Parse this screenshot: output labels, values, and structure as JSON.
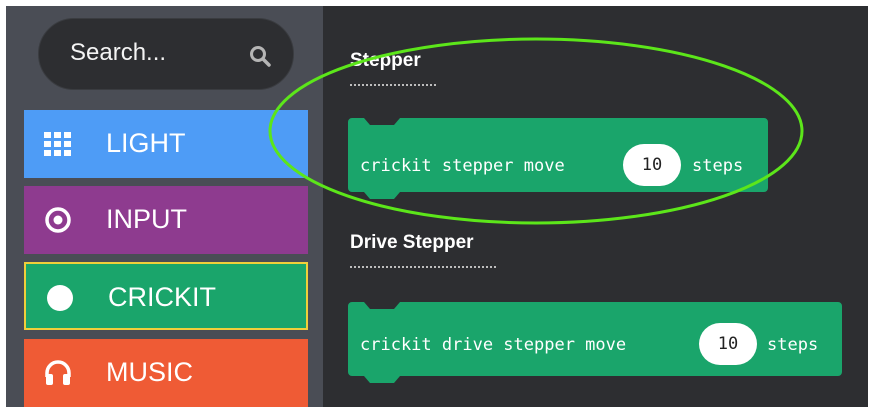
{
  "search": {
    "placeholder": "Search..."
  },
  "categories": [
    {
      "label": "LIGHT",
      "icon": "grid-icon",
      "color": "#4e9cf6"
    },
    {
      "label": "INPUT",
      "icon": "circle-target-icon",
      "color": "#8e3b8f"
    },
    {
      "label": "CRICKIT",
      "icon": "filled-circle-icon",
      "color": "#1aa56b"
    },
    {
      "label": "MUSIC",
      "icon": "headphones-icon",
      "color": "#ef5b35"
    }
  ],
  "flyout": {
    "sections": [
      {
        "heading": "Stepper",
        "block": {
          "prefix": "crickit stepper move",
          "value": "10",
          "suffix": "steps"
        }
      },
      {
        "heading": "Drive Stepper",
        "block": {
          "prefix": "crickit drive stepper move",
          "value": "10",
          "suffix": "steps"
        }
      }
    ]
  },
  "colors": {
    "block_green": "#1aa56b",
    "highlight_ellipse": "#5ce61a",
    "selected_border": "#f0cf3a"
  }
}
